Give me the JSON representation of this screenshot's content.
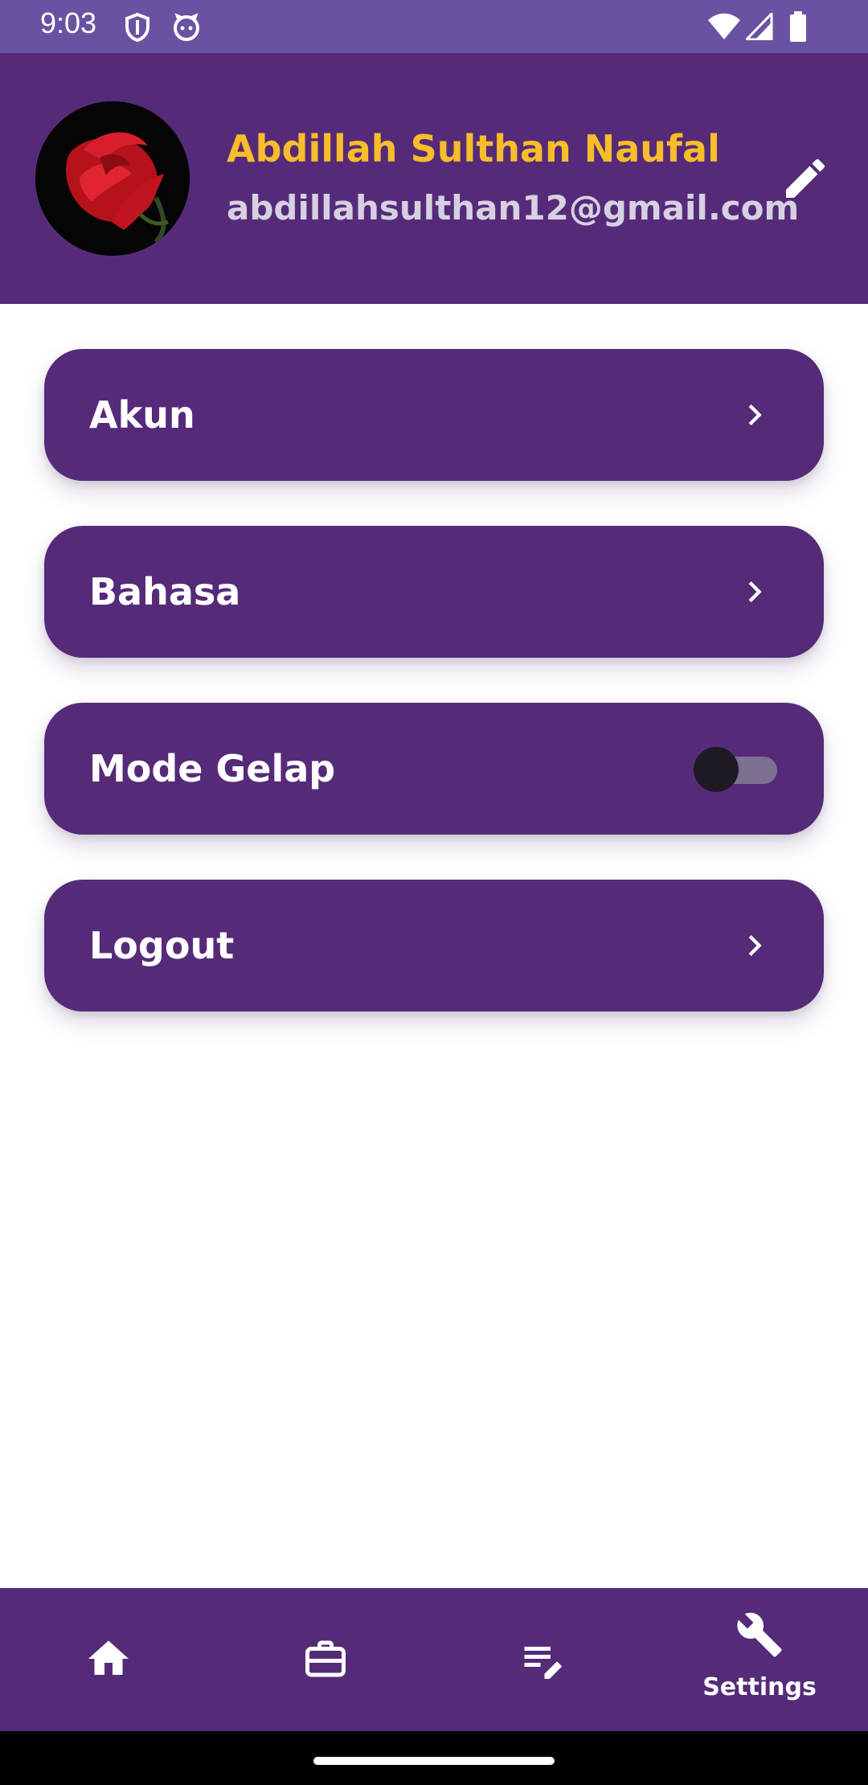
{
  "status_bar": {
    "time": "9:03",
    "icons": [
      "shield-icon",
      "cat-face-icon",
      "wifi-icon",
      "cell-signal-icon",
      "battery-icon"
    ]
  },
  "profile": {
    "name": "Abdillah Sulthan Naufal",
    "email": "abdillahsulthan12@gmail.com",
    "avatar": "red-rose-photo",
    "edit_icon": "pencil-icon"
  },
  "menu": [
    {
      "label": "Akun",
      "trailing": "chevron-right-icon"
    },
    {
      "label": "Bahasa",
      "trailing": "chevron-right-icon"
    },
    {
      "label": "Mode Gelap",
      "trailing": "toggle",
      "toggle_on": false
    },
    {
      "label": "Logout",
      "trailing": "chevron-right-icon"
    }
  ],
  "bottom_nav": {
    "items": [
      {
        "icon": "home-icon",
        "label": ""
      },
      {
        "icon": "briefcase-icon",
        "label": ""
      },
      {
        "icon": "edit-list-icon",
        "label": ""
      },
      {
        "icon": "wrench-icon",
        "label": "Settings",
        "active": true
      }
    ]
  },
  "colors": {
    "primary": "#552b79",
    "status_bar": "#6a52a3",
    "name_accent": "#f7bd2a",
    "email": "#d6d0e2"
  }
}
